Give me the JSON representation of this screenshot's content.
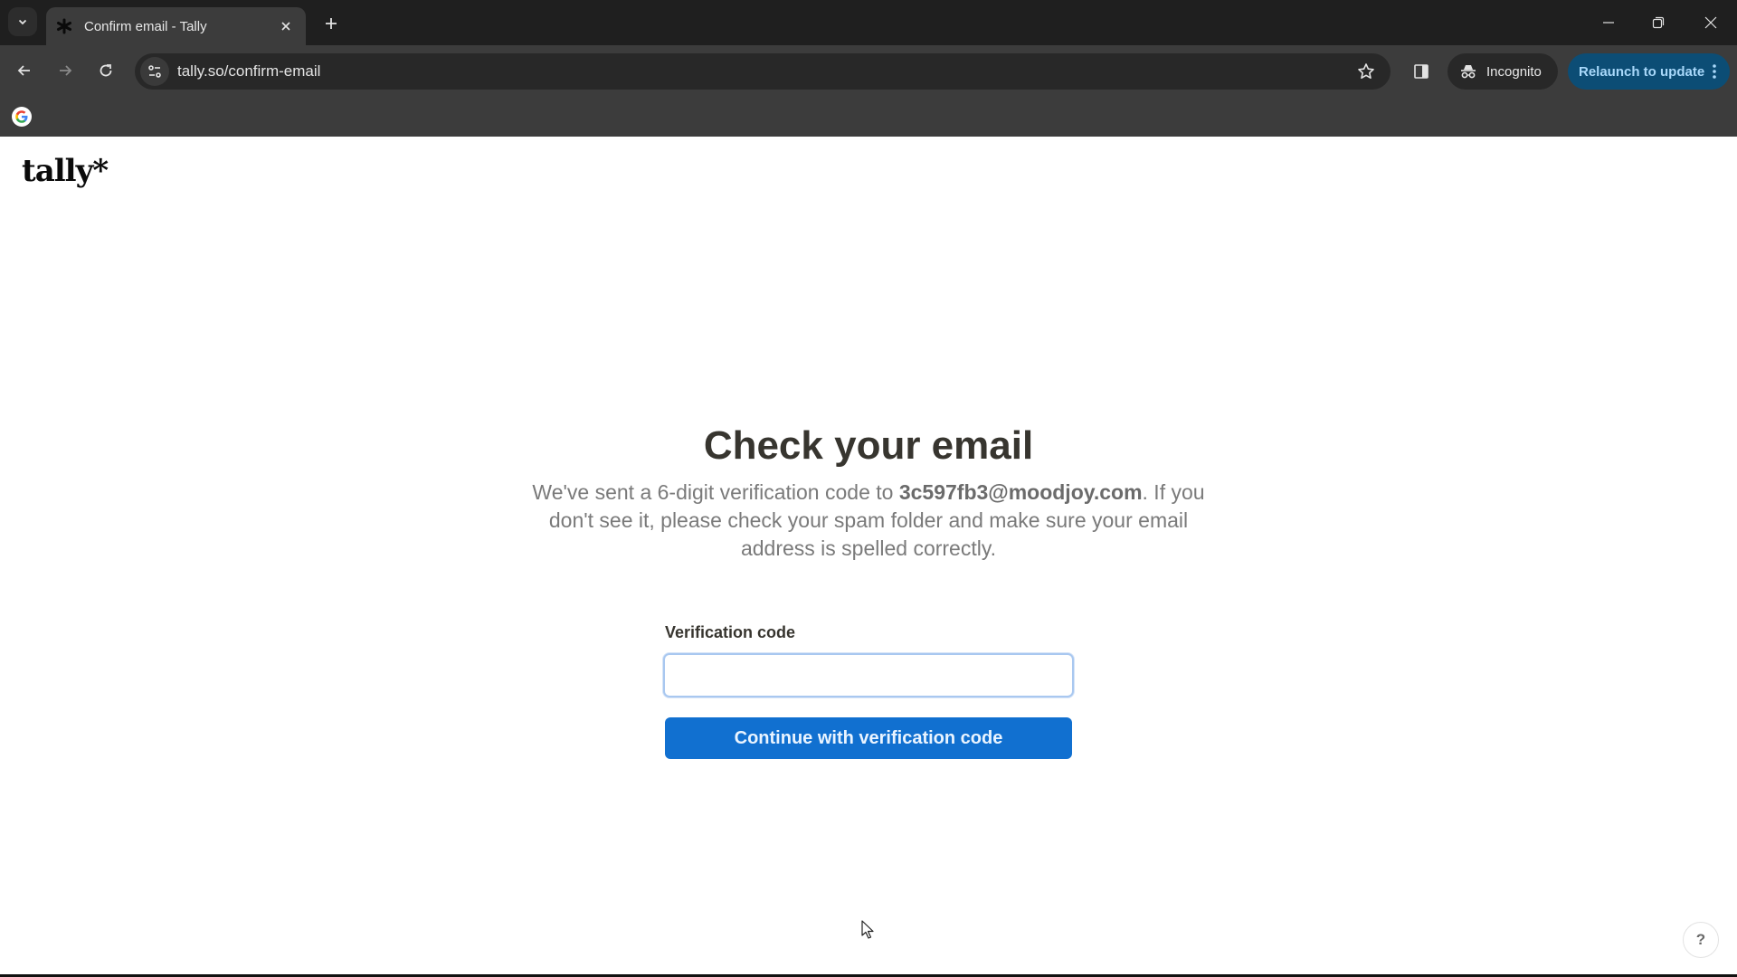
{
  "browser": {
    "tab": {
      "title": "Confirm email - Tally",
      "favicon": "tally-asterisk-icon"
    },
    "address_bar": {
      "url": "tally.so/confirm-email"
    },
    "incognito_label": "Incognito",
    "relaunch_label": "Relaunch to update",
    "colors": {
      "relaunch_bg": "#0c4d75",
      "relaunch_text": "#a8d8fa"
    },
    "bookmarks": [
      {
        "icon": "google-icon"
      }
    ]
  },
  "page": {
    "logo": "tally*",
    "heading": "Check your email",
    "description": {
      "before": "We've sent a 6-digit verification code to ",
      "email": "3c597fb3@moodjoy.com",
      "after": ". If you don't see it, please check your spam folder and make sure your email address is spelled correctly."
    },
    "form": {
      "label": "Verification code",
      "input_value": "",
      "input_placeholder": "",
      "submit_label": "Continue with verification code"
    },
    "help_label": "?",
    "colors": {
      "primary_button": "#1170d0",
      "input_focus_ring": "#a9c8f0",
      "heading": "#37352f",
      "body_text": "#7a7a7a"
    }
  }
}
